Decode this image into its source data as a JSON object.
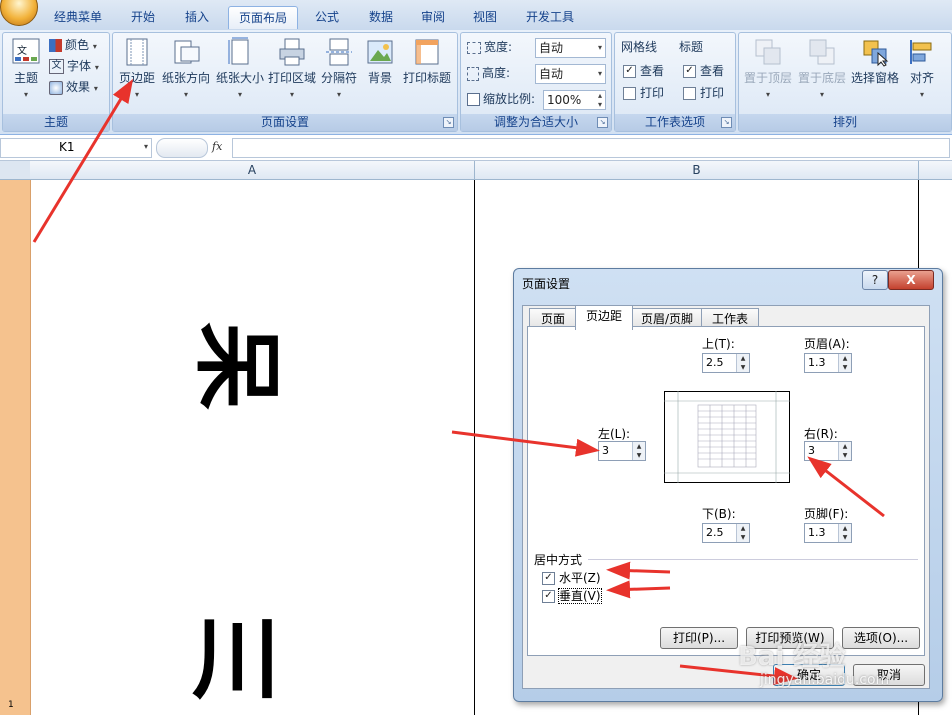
{
  "tabs": [
    "经典菜单",
    "开始",
    "插入",
    "页面布局",
    "公式",
    "数据",
    "审阅",
    "视图",
    "开发工具"
  ],
  "active_tab": "页面布局",
  "ribbon": {
    "theme_group": {
      "label": "主题",
      "theme_btn": "主题",
      "colors": "颜色",
      "fonts": "字体",
      "effects": "效果"
    },
    "page_setup_group": {
      "label": "页面设置",
      "buttons": [
        "页边距",
        "纸张方向",
        "纸张大小",
        "打印区域",
        "分隔符",
        "背景",
        "打印标题"
      ]
    },
    "scale_group": {
      "label": "调整为合适大小",
      "width_label": "宽度:",
      "width_value": "自动",
      "height_label": "高度:",
      "height_value": "自动",
      "scale_label": "缩放比例:",
      "scale_value": "100%"
    },
    "sheet_options_group": {
      "label": "工作表选项",
      "gridlines": "网格线",
      "headings": "标题",
      "view": "查看",
      "print": "打印",
      "gridlines_view_checked": true,
      "gridlines_print_checked": false,
      "headings_view_checked": true,
      "headings_print_checked": false
    },
    "arrange_group": {
      "label": "排列",
      "buttons": [
        "置于顶层",
        "置于底层",
        "选择窗格",
        "对齐"
      ]
    }
  },
  "formula_bar": {
    "name_box": "K1",
    "fx": "fx",
    "content": ""
  },
  "columns": [
    "A",
    "B"
  ],
  "row_numbers": [
    "1"
  ],
  "sheet_text": {
    "top_glyph": "呆",
    "bottom_glyph": "川"
  },
  "dialog": {
    "title": "页面设置",
    "help": "?",
    "close": "X",
    "tabs": [
      "页面",
      "页边距",
      "页眉/页脚",
      "工作表"
    ],
    "selected_tab": "页边距",
    "top_label": "上(T):",
    "top_value": "2.5",
    "header_label": "页眉(A):",
    "header_value": "1.3",
    "left_label": "左(L):",
    "left_value": "3",
    "right_label": "右(R):",
    "right_value": "3",
    "bottom_label": "下(B):",
    "bottom_value": "2.5",
    "footer_label": "页脚(F):",
    "footer_value": "1.3",
    "center_label": "居中方式",
    "horizontal_label": "水平(Z)",
    "horizontal_checked": true,
    "vertical_label": "垂直(V)",
    "vertical_checked": true,
    "print_btn": "打印(P)...",
    "preview_btn": "打印预览(W)",
    "options_btn": "选项(O)...",
    "ok_btn": "确定",
    "cancel_btn": "取消"
  },
  "watermark": {
    "text": "Bai 经验",
    "url": "jingyan.baidu.com"
  },
  "colors": {
    "accent": "#15428b",
    "arrow": "#e8332c",
    "row_strip": "#f5c28e"
  }
}
